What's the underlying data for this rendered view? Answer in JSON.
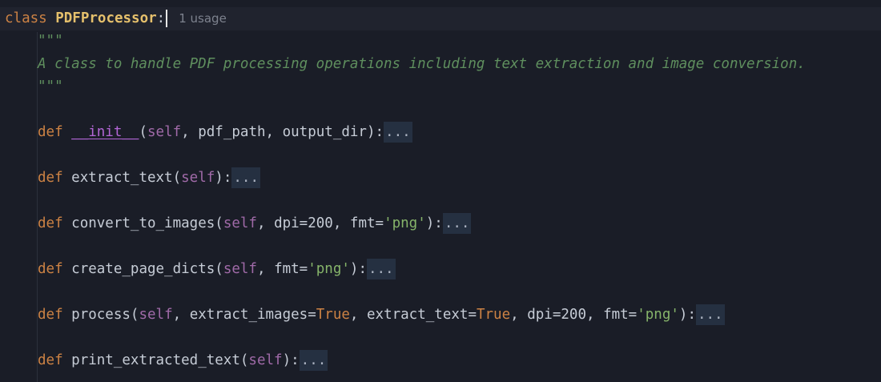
{
  "class_line": {
    "keyword": "class",
    "name": "PDFProcessor",
    "colon": ":",
    "usage_hint": "1 usage"
  },
  "docstring": {
    "open": "\"\"\"",
    "text": "A class to handle PDF processing operations including text extraction and image conversion.",
    "close": "\"\"\""
  },
  "methods": [
    {
      "keyword": "def",
      "name": "__init__",
      "tokens": [
        {
          "t": "(",
          "c": "punct"
        },
        {
          "t": "self",
          "c": "selfp"
        },
        {
          "t": ", ",
          "c": "punct"
        },
        {
          "t": "pdf_path",
          "c": "param"
        },
        {
          "t": ", ",
          "c": "punct"
        },
        {
          "t": "output_dir",
          "c": "param"
        },
        {
          "t": "):",
          "c": "punct"
        }
      ],
      "fold": "..."
    },
    {
      "keyword": "def",
      "name": "extract_text",
      "tokens": [
        {
          "t": "(",
          "c": "punct"
        },
        {
          "t": "self",
          "c": "selfp"
        },
        {
          "t": "):",
          "c": "punct"
        }
      ],
      "fold": "..."
    },
    {
      "keyword": "def",
      "name": "convert_to_images",
      "tokens": [
        {
          "t": "(",
          "c": "punct"
        },
        {
          "t": "self",
          "c": "selfp"
        },
        {
          "t": ", ",
          "c": "punct"
        },
        {
          "t": "dpi",
          "c": "param"
        },
        {
          "t": "=",
          "c": "punct"
        },
        {
          "t": "200",
          "c": "num"
        },
        {
          "t": ", ",
          "c": "punct"
        },
        {
          "t": "fmt",
          "c": "param"
        },
        {
          "t": "=",
          "c": "punct"
        },
        {
          "t": "'png'",
          "c": "str"
        },
        {
          "t": "):",
          "c": "punct"
        }
      ],
      "fold": "..."
    },
    {
      "keyword": "def",
      "name": "create_page_dicts",
      "tokens": [
        {
          "t": "(",
          "c": "punct"
        },
        {
          "t": "self",
          "c": "selfp"
        },
        {
          "t": ", ",
          "c": "punct"
        },
        {
          "t": "fmt",
          "c": "param"
        },
        {
          "t": "=",
          "c": "punct"
        },
        {
          "t": "'png'",
          "c": "str"
        },
        {
          "t": "):",
          "c": "punct"
        }
      ],
      "fold": "..."
    },
    {
      "keyword": "def",
      "name": "process",
      "tokens": [
        {
          "t": "(",
          "c": "punct"
        },
        {
          "t": "self",
          "c": "selfp"
        },
        {
          "t": ", ",
          "c": "punct"
        },
        {
          "t": "extract_images",
          "c": "param"
        },
        {
          "t": "=",
          "c": "punct"
        },
        {
          "t": "True",
          "c": "const"
        },
        {
          "t": ", ",
          "c": "punct"
        },
        {
          "t": "extract_text",
          "c": "param"
        },
        {
          "t": "=",
          "c": "punct"
        },
        {
          "t": "True",
          "c": "const"
        },
        {
          "t": ", ",
          "c": "punct"
        },
        {
          "t": "dpi",
          "c": "param"
        },
        {
          "t": "=",
          "c": "punct"
        },
        {
          "t": "200",
          "c": "num"
        },
        {
          "t": ", ",
          "c": "punct"
        },
        {
          "t": "fmt",
          "c": "param"
        },
        {
          "t": "=",
          "c": "punct"
        },
        {
          "t": "'png'",
          "c": "str"
        },
        {
          "t": "):",
          "c": "punct"
        }
      ],
      "fold": "..."
    },
    {
      "keyword": "def",
      "name": "print_extracted_text",
      "tokens": [
        {
          "t": "(",
          "c": "punct"
        },
        {
          "t": "self",
          "c": "selfp"
        },
        {
          "t": "):",
          "c": "punct"
        }
      ],
      "fold": "..."
    }
  ],
  "colors": {
    "background": "#1a1d27",
    "keyword": "#cc8244",
    "class_name": "#e5c06c",
    "docstring": "#5f8f5e",
    "string": "#86b46a",
    "self": "#a06aa8",
    "dunder": "#b366d6"
  }
}
